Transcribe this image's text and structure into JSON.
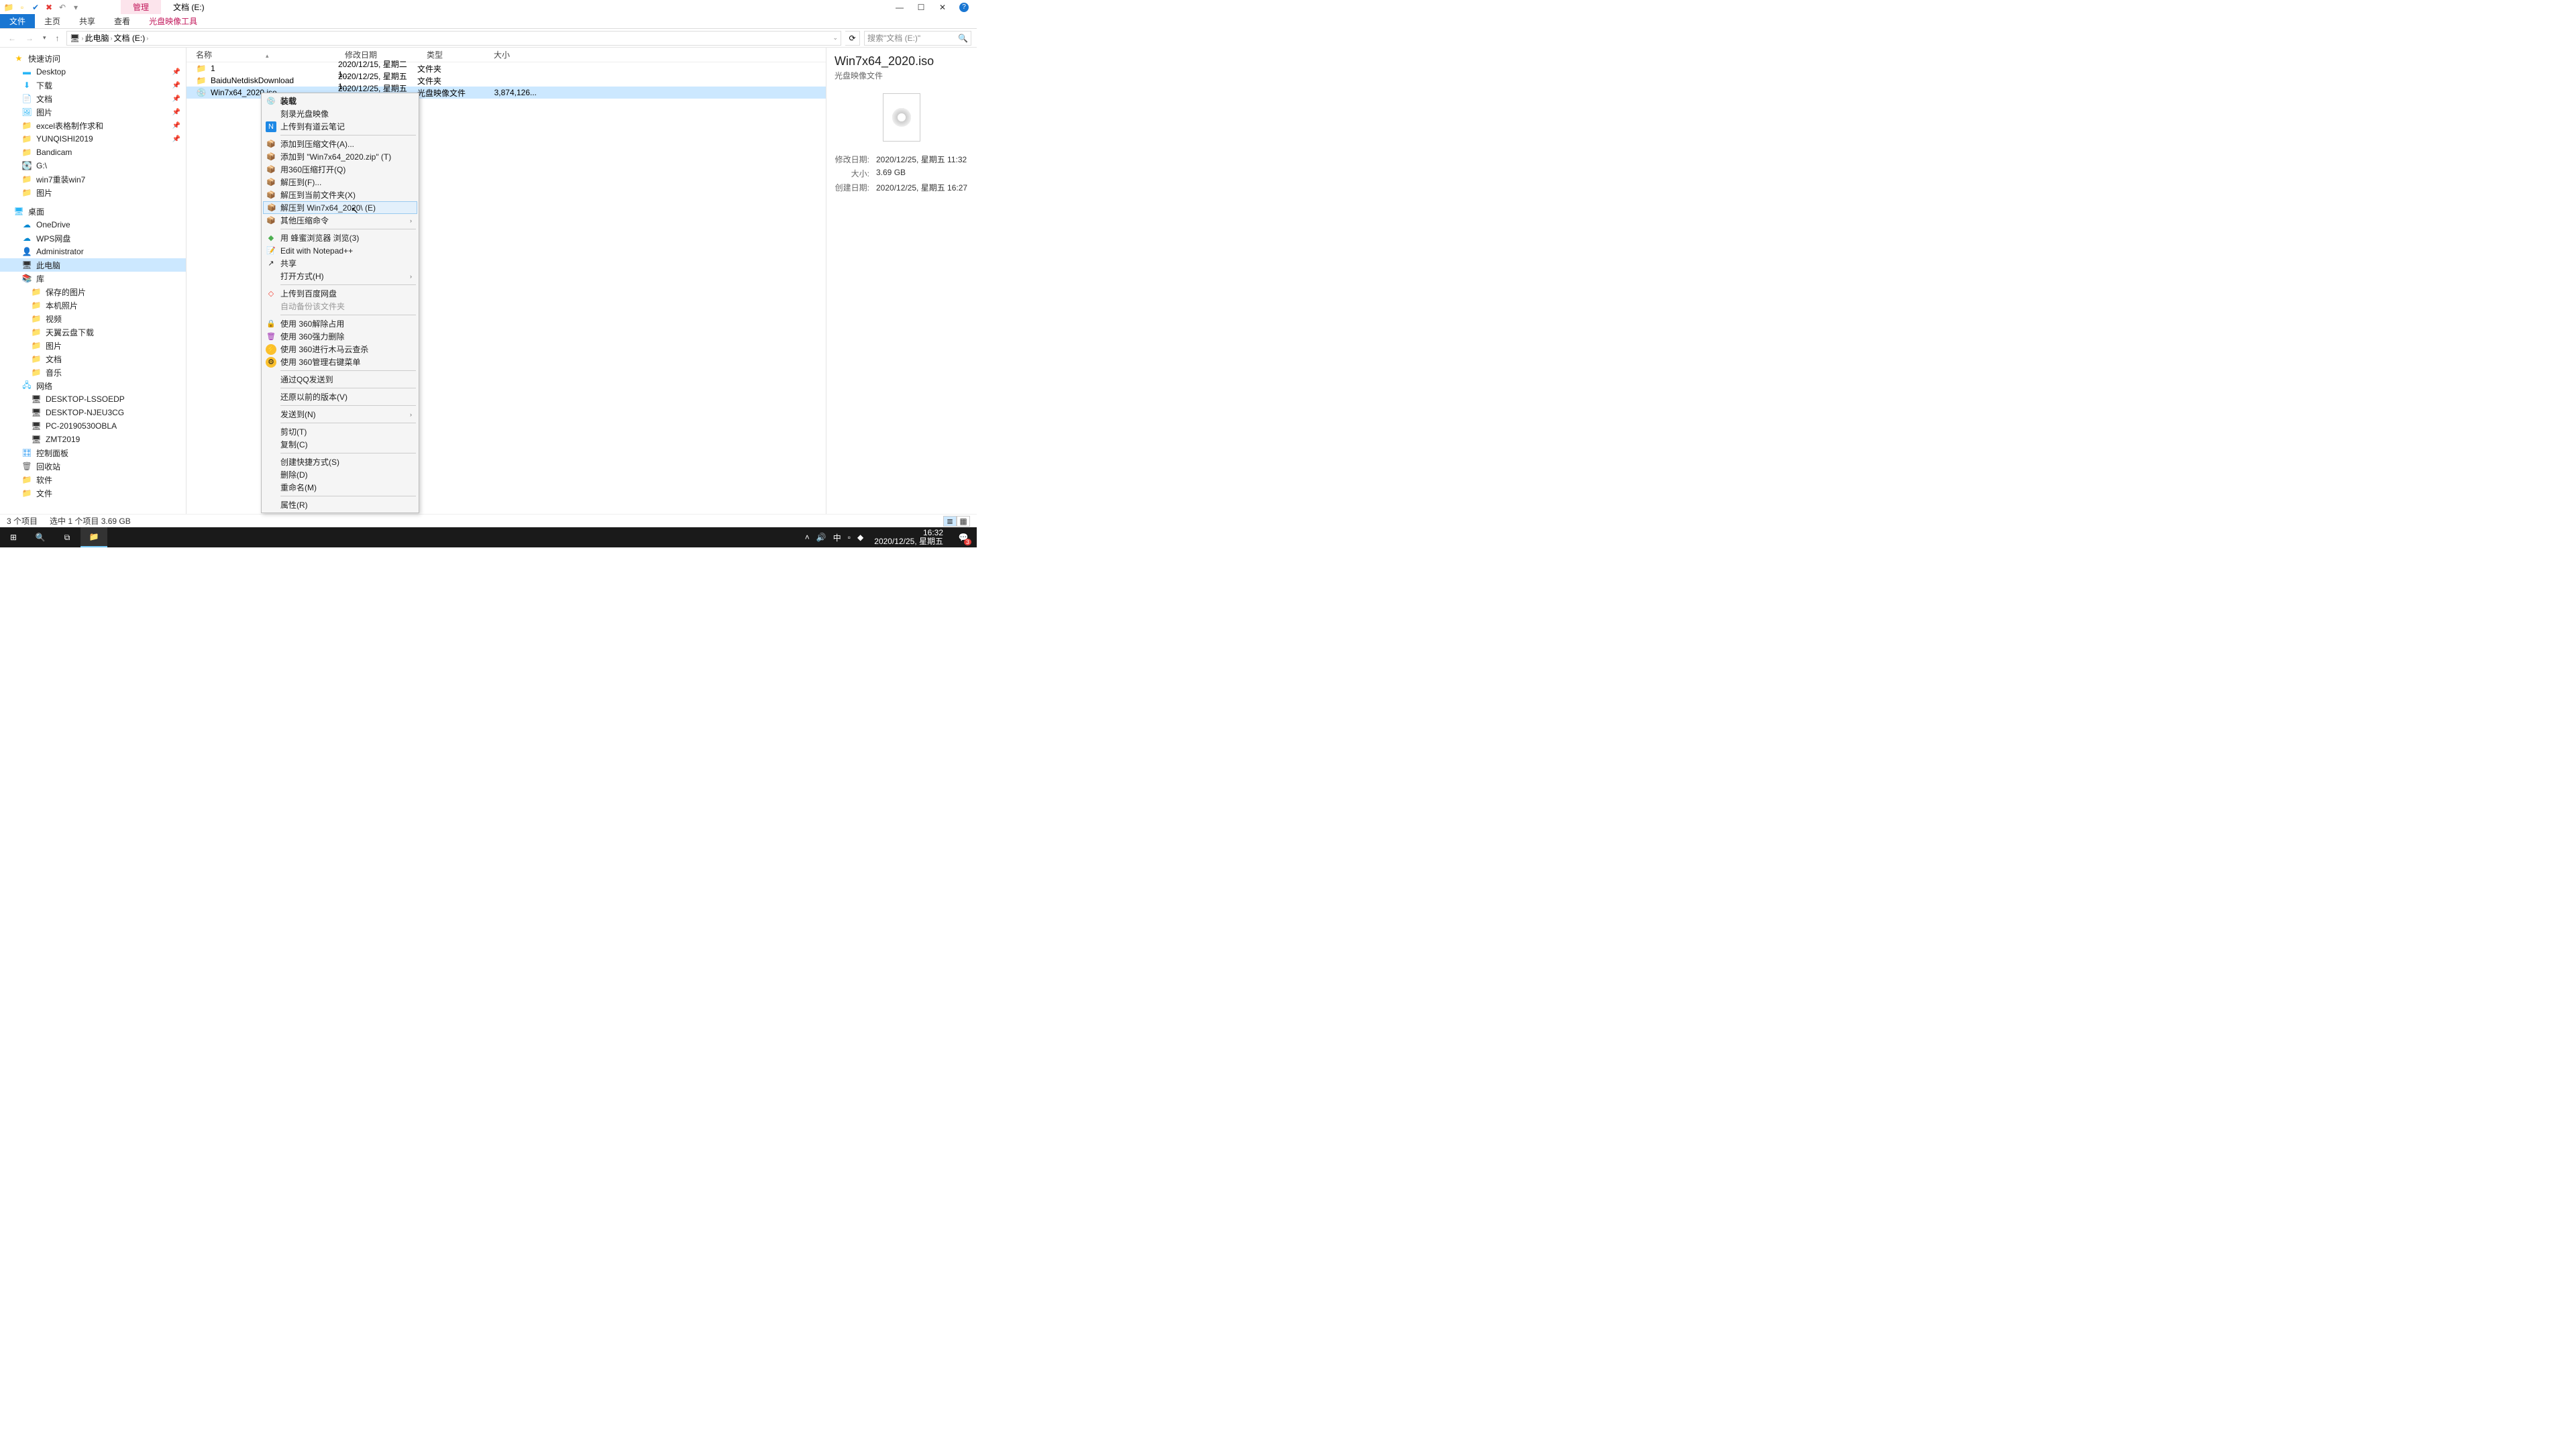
{
  "title_tabs": {
    "manage": "管理",
    "drive": "文档 (E:)"
  },
  "ribbon": {
    "file": "文件",
    "home": "主页",
    "share": "共享",
    "view": "查看",
    "disc": "光盘映像工具"
  },
  "breadcrumb": {
    "pc": "此电脑",
    "drive": "文档 (E:)"
  },
  "search_placeholder": "搜索\"文档 (E:)\"",
  "nav": {
    "quick": "快速访问",
    "desktop": "Desktop",
    "downloads": "下载",
    "documents": "文档",
    "pictures": "图片",
    "excel": "excel表格制作求和",
    "yunqishi": "YUNQISHI2019",
    "bandicam": "Bandicam",
    "gdrive": "G:\\",
    "win7reinstall": "win7重装win7",
    "pictures2": "图片",
    "desktop_group": "桌面",
    "onedrive": "OneDrive",
    "wps": "WPS网盘",
    "admin": "Administrator",
    "thispc": "此电脑",
    "library": "库",
    "saved_pics": "保存的图片",
    "local_pics": "本机照片",
    "videos": "视频",
    "tianyi": "天翼云盘下载",
    "pictures3": "图片",
    "documents2": "文档",
    "music": "音乐",
    "network": "网络",
    "pc1": "DESKTOP-LSSOEDP",
    "pc2": "DESKTOP-NJEU3CG",
    "pc3": "PC-20190530OBLA",
    "pc4": "ZMT2019",
    "ctrlpanel": "控制面板",
    "recycle": "回收站",
    "software": "软件",
    "files": "文件"
  },
  "columns": {
    "name": "名称",
    "date": "修改日期",
    "type": "类型",
    "size": "大小"
  },
  "rows": [
    {
      "name": "1",
      "date": "2020/12/15, 星期二 1...",
      "type": "文件夹",
      "size": ""
    },
    {
      "name": "BaiduNetdiskDownload",
      "date": "2020/12/25, 星期五 1...",
      "type": "文件夹",
      "size": ""
    },
    {
      "name": "Win7x64_2020.iso",
      "date": "2020/12/25, 星期五 1...",
      "type": "光盘映像文件",
      "size": "3,874,126..."
    }
  ],
  "context_menu": {
    "mount": "装载",
    "burn": "刻录光盘映像",
    "youdao": "上传到有道云笔记",
    "addarchive": "添加到压缩文件(A)...",
    "addzip": "添加到 \"Win7x64_2020.zip\" (T)",
    "openwith360": "用360压缩打开(Q)",
    "extractto": "解压到(F)...",
    "extracthere": "解压到当前文件夹(X)",
    "extractfolder": "解压到 Win7x64_2020\\ (E)",
    "othercompress": "其他压缩命令",
    "browser": "用 蜂蜜浏览器 浏览(3)",
    "notepad": "Edit with Notepad++",
    "share": "共享",
    "openwith": "打开方式(H)",
    "baidupan": "上传到百度网盘",
    "autobackup": "自动备份该文件夹",
    "u360release": "使用 360解除占用",
    "u360force": "使用 360强力删除",
    "u360trojan": "使用 360进行木马云查杀",
    "u360menu": "使用 360管理右键菜单",
    "qqsend": "通过QQ发送到",
    "restore": "还原以前的版本(V)",
    "sendto": "发送到(N)",
    "cut": "剪切(T)",
    "copy": "复制(C)",
    "shortcut": "创建快捷方式(S)",
    "delete": "删除(D)",
    "rename": "重命名(M)",
    "properties": "属性(R)"
  },
  "details": {
    "title": "Win7x64_2020.iso",
    "subtitle": "光盘映像文件",
    "mod_label": "修改日期:",
    "mod_val": "2020/12/25, 星期五 11:32",
    "size_label": "大小:",
    "size_val": "3.69 GB",
    "created_label": "创建日期:",
    "created_val": "2020/12/25, 星期五 16:27"
  },
  "status": {
    "count": "3 个项目",
    "selected": "选中 1 个项目  3.69 GB"
  },
  "taskbar": {
    "ime": "中",
    "time": "16:32",
    "date": "2020/12/25, 星期五",
    "badge": "3"
  }
}
